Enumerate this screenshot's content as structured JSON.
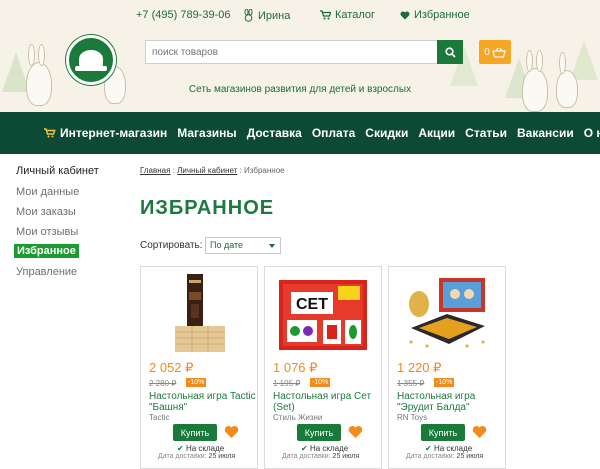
{
  "header": {
    "phone": "+7 (495) 789-39-06",
    "user": "Ирина",
    "catalog": "Каталог",
    "favorites": "Избранное",
    "search_placeholder": "поиск товаров",
    "cart_count": "0",
    "tagline": "Сеть магазинов развития для детей и взрослых"
  },
  "nav": {
    "items": [
      "Интернет-магазин",
      "Магазины",
      "Доставка",
      "Оплата",
      "Скидки",
      "Акции",
      "Статьи",
      "Вакансии",
      "О нас"
    ]
  },
  "sidebar": {
    "title": "Личный кабинет",
    "items": [
      "Мои данные",
      "Мои заказы",
      "Мои отзывы",
      "Избранное",
      "Управление"
    ],
    "active": "Избранное"
  },
  "breadcrumb": {
    "home": "Главная",
    "separator": ":",
    "account": "Личный кабинет",
    "current": "Избранное"
  },
  "page": {
    "title": "ИЗБРАННОЕ",
    "sort_label": "Сортировать:",
    "sort_value": "По дате"
  },
  "products": [
    {
      "price": "2 052 ₽",
      "old_price": "2 280 ₽",
      "discount": "-10%",
      "name": "Настольная игра Tactic \"Башня\"",
      "brand": "Tactic",
      "buy_label": "Купить",
      "stock": "На складе",
      "delivery_label": "Дата доставки:",
      "delivery_date": "25 июля"
    },
    {
      "price": "1 076 ₽",
      "old_price": "1 195 ₽",
      "discount": "-10%",
      "name": "Настольная игра Сет (Set)",
      "brand": "Стиль Жизни",
      "buy_label": "Купить",
      "stock": "На складе",
      "delivery_label": "Дата доставки:",
      "delivery_date": "25 июля"
    },
    {
      "price": "1 220 ₽",
      "old_price": "1 355 ₽",
      "discount": "-10%",
      "name": "Настольная игра \"Эрудит Балда\"",
      "brand": "RN Toys",
      "buy_label": "Купить",
      "stock": "На складе",
      "delivery_label": "Дата доставки:",
      "delivery_date": "25 июля"
    }
  ],
  "colors": {
    "brand_green": "#1a7a3a",
    "nav_bg": "#0c4a35",
    "price_orange": "#f28b1e",
    "active_green": "#1a9a2f",
    "cart_orange": "#f5a623"
  },
  "icons": {
    "user": "rabbit-icon",
    "catalog": "cart-icon",
    "favorites": "heart-icon",
    "search": "search-icon",
    "cart": "basket-icon",
    "shop": "cart-icon",
    "wishlist": "heart-icon"
  }
}
